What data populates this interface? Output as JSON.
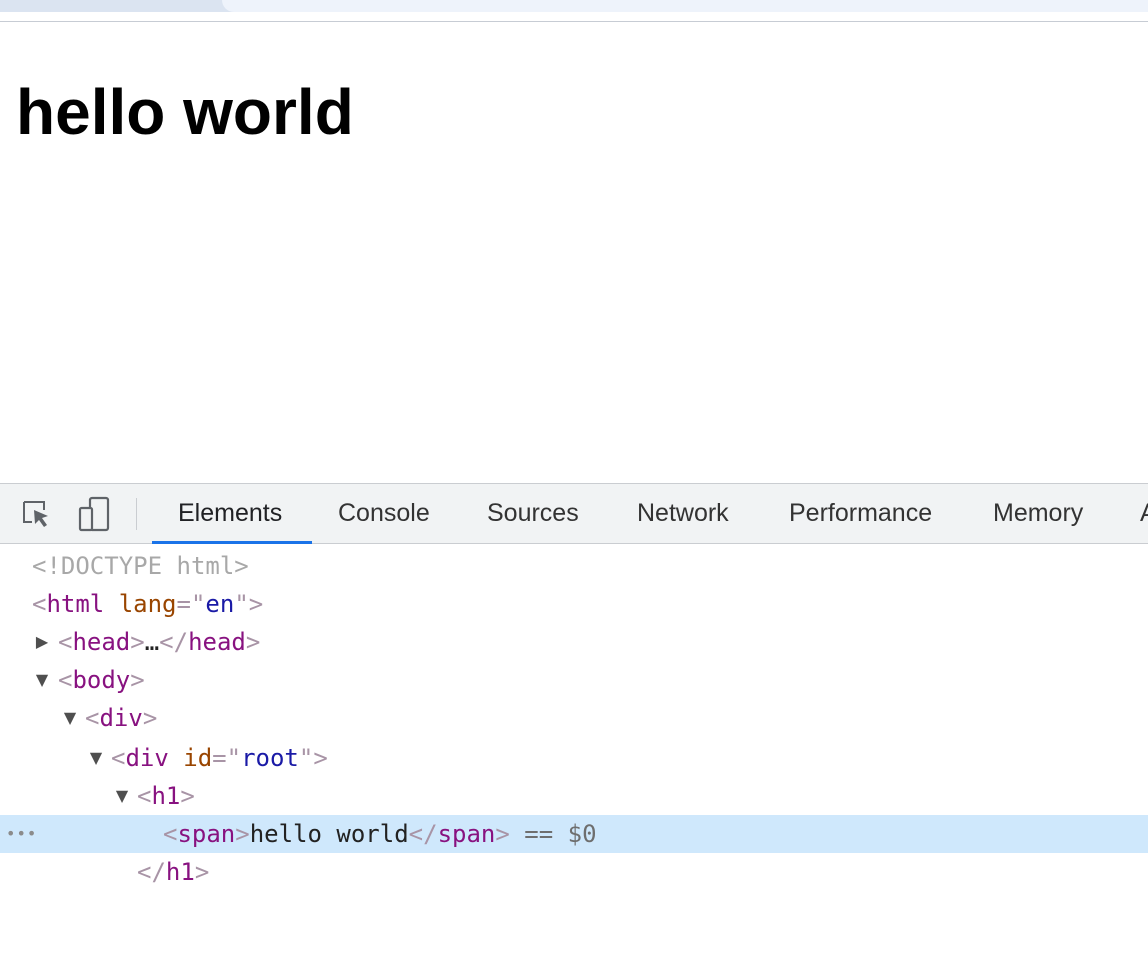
{
  "page": {
    "heading": "hello world"
  },
  "devtools": {
    "tabs": [
      "Elements",
      "Console",
      "Sources",
      "Network",
      "Performance",
      "Memory",
      "A"
    ],
    "active_tab": "Elements",
    "accent_color": "#1a73e8",
    "icons": [
      "inspect-element-icon",
      "device-toolbar-icon"
    ],
    "tree": {
      "doctype": "<!DOCTYPE html>",
      "html_tag": "html",
      "html_attr_name": "lang",
      "html_attr_value": "en",
      "head_tag": "head",
      "head_ellipsis": "…",
      "body_tag": "body",
      "div_tag": "div",
      "root_div_tag": "div",
      "root_attr_name": "id",
      "root_attr_value": "root",
      "h1_tag": "h1",
      "span_tag": "span",
      "span_text": "hello world",
      "selected_marker": "== $0",
      "h1_close_tag": "h1",
      "gutter_dots": "•••"
    }
  }
}
